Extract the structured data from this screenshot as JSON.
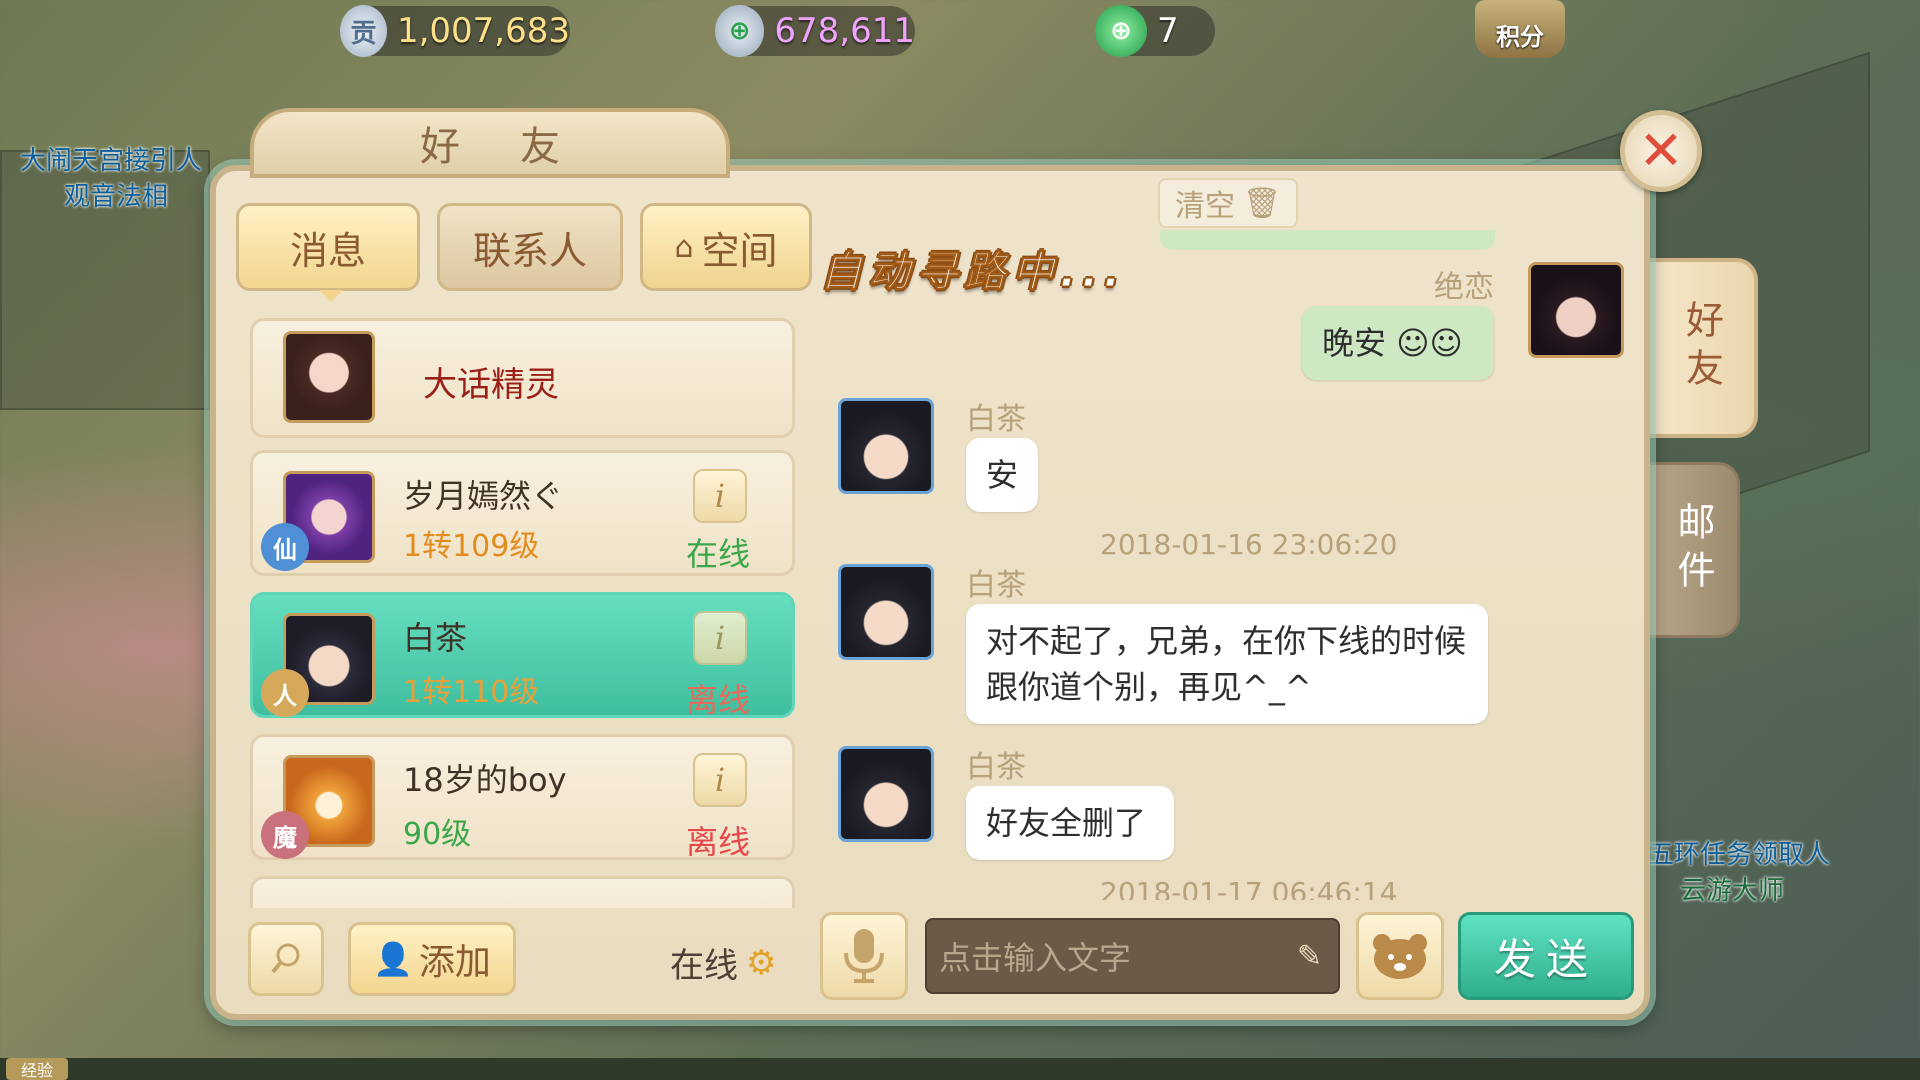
{
  "currency": {
    "contribution": "1,007,683",
    "silver": "678,611",
    "jade": "7",
    "points_label": "积分"
  },
  "background": {
    "npc1_line1": "大闹天宫接引人",
    "npc1_line2": "观音法相",
    "npc2_line1": "五环任务领取人",
    "npc2_line2": "云游大师"
  },
  "panel": {
    "title": "好友",
    "tabs": [
      "消息",
      "联系人",
      "空间"
    ],
    "clear_label": "清空",
    "auto_pathing": "自动寻路中..."
  },
  "friends": [
    {
      "name": "大话精灵",
      "level": "",
      "status": "",
      "race": ""
    },
    {
      "name": "岁月嫣然ぐ",
      "level": "1转109级",
      "status": "在线",
      "race": "仙"
    },
    {
      "name": "白茶",
      "level": "1转110级",
      "status": "离线",
      "race": "人"
    },
    {
      "name": "18岁的boy",
      "level": "90级",
      "status": "离线",
      "race": "魔"
    }
  ],
  "list_bottom": {
    "add_label": "添加",
    "online_filter": "在线"
  },
  "chat": {
    "messages": [
      {
        "sender": "绝恋",
        "text": "晚安",
        "mine": true
      },
      {
        "sender": "白茶",
        "text": "安",
        "mine": false
      },
      {
        "timestamp": "2018-01-16 23:06:20"
      },
      {
        "sender": "白茶",
        "text": "对不起了，兄弟，在你下线的时候跟你道个别，再见^_^",
        "mine": false
      },
      {
        "sender": "白茶",
        "text": "好友全删了",
        "mine": false
      },
      {
        "timestamp": "2018-01-17 06:46:14"
      }
    ],
    "input_placeholder": "点击输入文字",
    "send_label": "发送"
  },
  "side_tabs": {
    "friends": "好友",
    "mail": "邮件"
  },
  "exp_label": "经验",
  "colors": {
    "online": "#3aa84a",
    "offline": "#e5474a",
    "level": "#e38c1e",
    "accent_green": "#3fbf9f"
  }
}
